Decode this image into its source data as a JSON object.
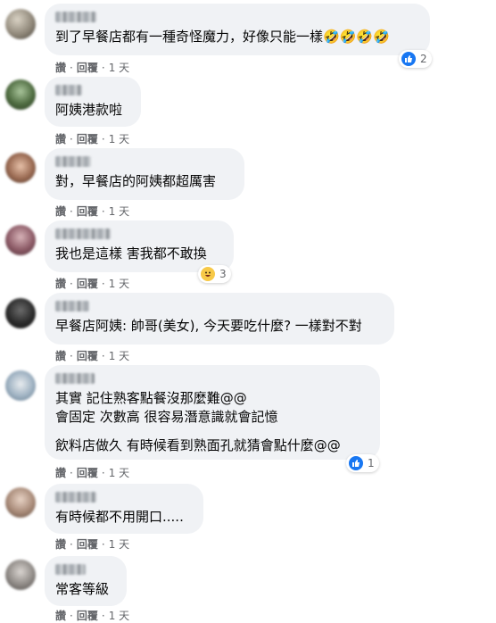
{
  "comments": [
    {
      "lines": [
        "到了早餐店都有一種奇怪魔力，好像只能一樣🤣🤣🤣🤣"
      ],
      "reactions": {
        "icons": [
          "like-icon"
        ],
        "count": "2"
      },
      "actions": {
        "like": "讚",
        "reply": "回覆",
        "time": "1 天"
      }
    },
    {
      "lines": [
        "阿姨港款啦"
      ],
      "actions": {
        "like": "讚",
        "reply": "回覆",
        "time": "1 天"
      }
    },
    {
      "lines": [
        "對，早餐店的阿姨都超厲害"
      ],
      "actions": {
        "like": "讚",
        "reply": "回覆",
        "time": "1 天"
      }
    },
    {
      "lines": [
        "我也是這樣 害我都不敢換"
      ],
      "reactions": {
        "icons": [
          "haha-icon"
        ],
        "count": "3"
      },
      "actions": {
        "like": "讚",
        "reply": "回覆",
        "time": "1 天"
      }
    },
    {
      "lines": [
        "早餐店阿姨: 帥哥(美女), 今天要吃什麼? 一樣對不對"
      ],
      "actions": {
        "like": "讚",
        "reply": "回覆",
        "time": "1 天"
      }
    },
    {
      "lines": [
        "其實 記住熟客點餐沒那麼難@@",
        "會固定 次數高 很容易潛意識就會記憶",
        "飲料店做久 有時候看到熟面孔就猜會點什麼@@"
      ],
      "reactions": {
        "icons": [
          "like-icon"
        ],
        "count": "1"
      },
      "actions": {
        "like": "讚",
        "reply": "回覆",
        "time": "1 天"
      }
    },
    {
      "lines": [
        "有時候都不用開口....."
      ],
      "actions": {
        "like": "讚",
        "reply": "回覆",
        "time": "1 天"
      }
    },
    {
      "lines": [
        "常客等級"
      ],
      "actions": {
        "like": "讚",
        "reply": "回覆",
        "time": "1 天"
      }
    }
  ],
  "colors": {
    "bubble": "#f0f2f5",
    "meta_text": "#65676b",
    "like_blue": "#1877f2",
    "emoji_yellow": "#f7c948"
  }
}
